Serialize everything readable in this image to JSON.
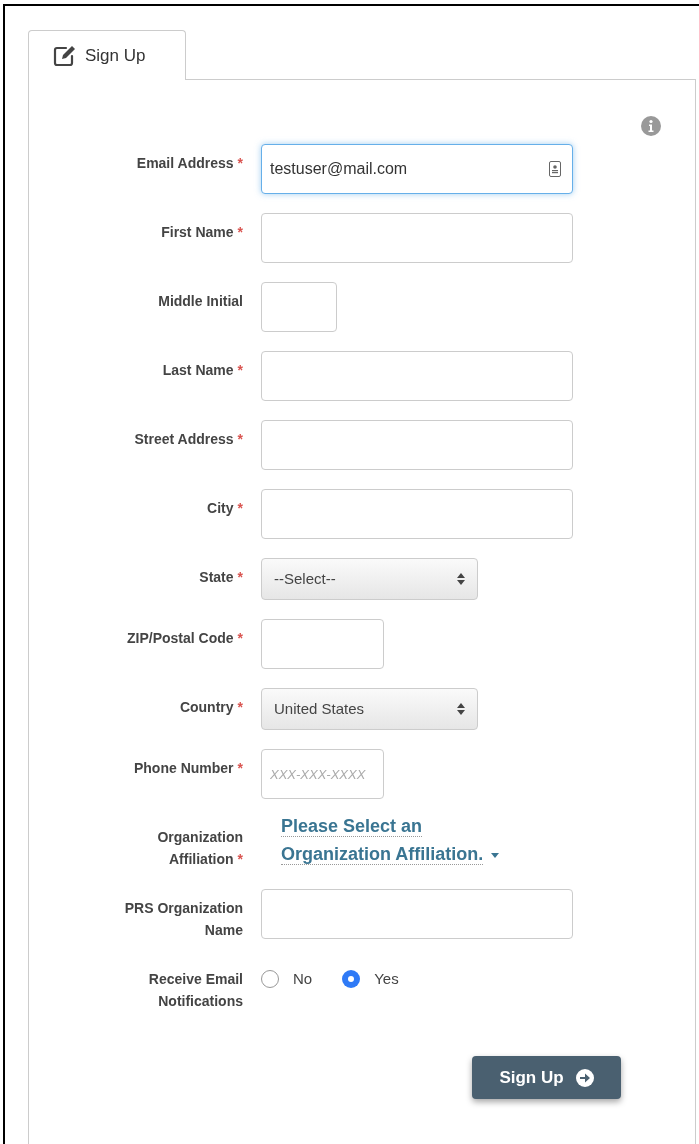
{
  "tab": {
    "label": "Sign Up",
    "selected": true
  },
  "fields": [
    {
      "kind": "text",
      "label": "Email Address",
      "marker": "*",
      "value": "testuser@mail.com",
      "focused": true
    },
    {
      "kind": "text",
      "label": "First Name",
      "marker": "*"
    },
    {
      "kind": "tiny",
      "label": "Middle Initial"
    },
    {
      "kind": "text",
      "label": "Last Name",
      "marker": "*"
    },
    {
      "kind": "text",
      "label": "Street Address",
      "marker": "*"
    },
    {
      "kind": "text",
      "label": "City",
      "marker": "*"
    },
    {
      "kind": "select",
      "label": "State",
      "marker": "*",
      "value": "--Select--"
    },
    {
      "kind": "short",
      "label": "ZIP/Postal Code",
      "marker": "*"
    },
    {
      "kind": "select",
      "label": "Country",
      "marker": "*",
      "value": "United States"
    },
    {
      "kind": "short",
      "label": "Phone Number",
      "marker": "*",
      "placeholder": "XXX-XXX-XXXX"
    },
    {
      "kind": "dropdown-link",
      "label": "Organization Affiliation",
      "marker": "*",
      "value": "Please Select an Organization Affiliation."
    },
    {
      "kind": "text",
      "label": "PRS Organization Name"
    },
    {
      "kind": "radio",
      "label": "Receive Email Notifications",
      "options": [
        {
          "label": "No",
          "selected": false
        },
        {
          "label": "Yes",
          "selected": true
        }
      ]
    }
  ],
  "submit": {
    "label": "Sign Up"
  }
}
